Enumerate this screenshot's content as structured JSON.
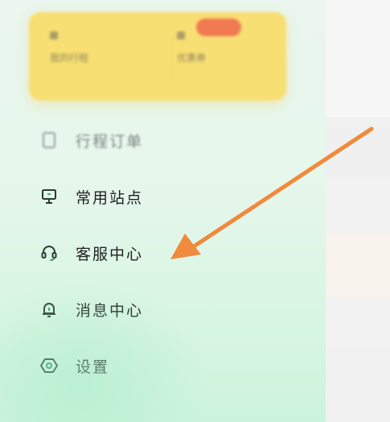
{
  "card": {
    "left_label": "我的行程",
    "right_label": "优惠券"
  },
  "menu": {
    "items": [
      {
        "label": "行程订单",
        "icon": "document-icon"
      },
      {
        "label": "常用站点",
        "icon": "monitor-icon"
      },
      {
        "label": "客服中心",
        "icon": "headset-icon"
      },
      {
        "label": "消息中心",
        "icon": "bell-icon"
      },
      {
        "label": "设置",
        "icon": "settings-icon"
      }
    ]
  },
  "colors": {
    "card_bg": "#f8df73",
    "badge": "#f07a52",
    "icon_green": "#2f8f5c",
    "arrow": "#f08a3c"
  }
}
